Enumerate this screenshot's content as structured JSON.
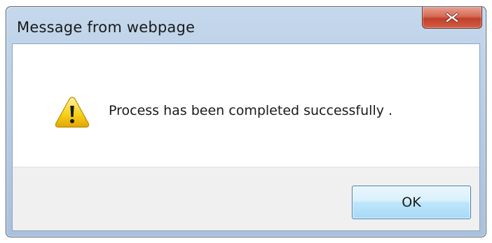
{
  "dialog": {
    "title": "Message from webpage",
    "message": "Process has been completed successfully .",
    "ok_label": "OK"
  },
  "icons": {
    "alert": "warning-icon",
    "close": "close-icon"
  },
  "colors": {
    "close_button": "#c7432d",
    "ok_button_border": "#3c7fb1",
    "warning_fill": "#f5c400"
  }
}
